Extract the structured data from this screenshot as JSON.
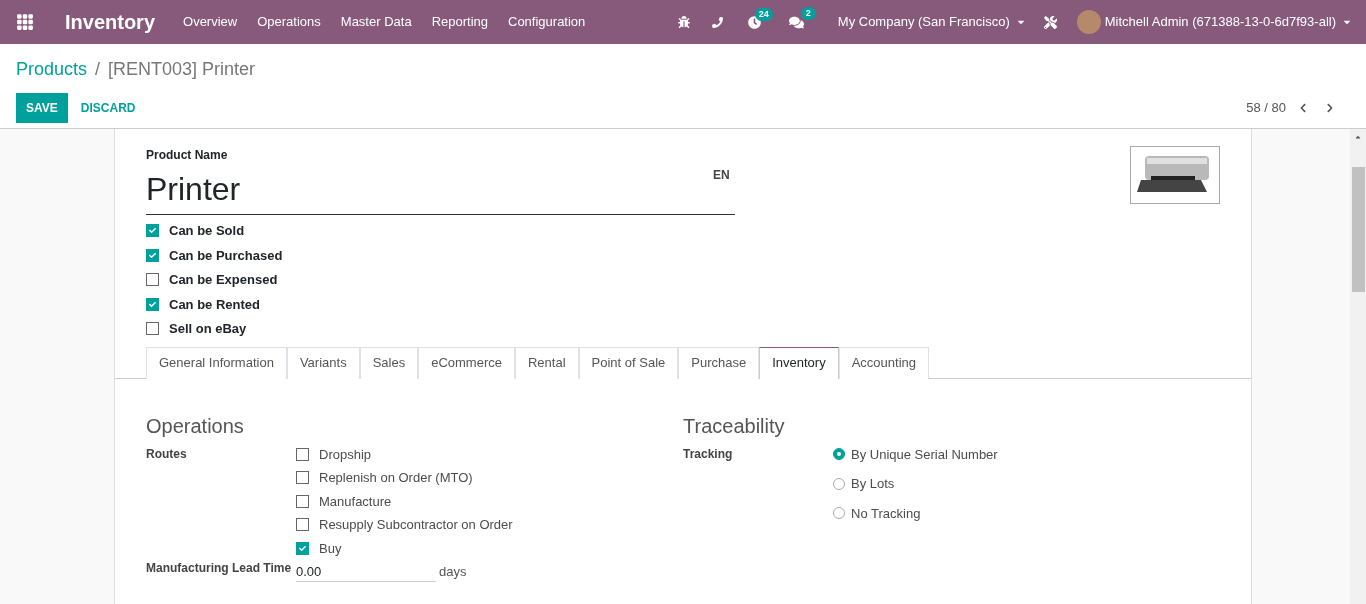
{
  "navbar": {
    "app_title": "Inventory",
    "menu": [
      "Overview",
      "Operations",
      "Master Data",
      "Reporting",
      "Configuration"
    ],
    "activity_count": "24",
    "message_count": "2",
    "company": "My Company (San Francisco)",
    "user": "Mitchell Admin (671388-13-0-6d7f93-all)"
  },
  "breadcrumb": {
    "parent": "Products",
    "separator": "/",
    "current": "[RENT003] Printer"
  },
  "buttons": {
    "save": "SAVE",
    "discard": "DISCARD"
  },
  "pager": "58 / 80",
  "product": {
    "name_label": "Product Name",
    "name": "Printer",
    "lang": "EN",
    "flags": [
      {
        "label": "Can be Sold",
        "checked": true
      },
      {
        "label": "Can be Purchased",
        "checked": true
      },
      {
        "label": "Can be Expensed",
        "checked": false
      },
      {
        "label": "Can be Rented",
        "checked": true
      },
      {
        "label": "Sell on eBay",
        "checked": false
      }
    ]
  },
  "tabs": [
    {
      "label": "General Information",
      "selected": false
    },
    {
      "label": "Variants",
      "selected": false
    },
    {
      "label": "Sales",
      "selected": false
    },
    {
      "label": "eCommerce",
      "selected": false
    },
    {
      "label": "Rental",
      "selected": false
    },
    {
      "label": "Point of Sale",
      "selected": false
    },
    {
      "label": "Purchase",
      "selected": false
    },
    {
      "label": "Inventory",
      "selected": true
    },
    {
      "label": "Accounting",
      "selected": false
    }
  ],
  "operations": {
    "title": "Operations",
    "routes_label": "Routes",
    "routes": [
      {
        "label": "Dropship",
        "checked": false
      },
      {
        "label": "Replenish on Order (MTO)",
        "checked": false
      },
      {
        "label": "Manufacture",
        "checked": false
      },
      {
        "label": "Resupply Subcontractor on Order",
        "checked": false
      },
      {
        "label": "Buy",
        "checked": true
      }
    ],
    "lead_time_label": "Manufacturing Lead Time",
    "lead_time_value": "0.00",
    "lead_time_unit": "days"
  },
  "traceability": {
    "title": "Traceability",
    "tracking_label": "Tracking",
    "options": [
      {
        "label": "By Unique Serial Number",
        "selected": true
      },
      {
        "label": "By Lots",
        "selected": false
      },
      {
        "label": "No Tracking",
        "selected": false
      }
    ]
  }
}
